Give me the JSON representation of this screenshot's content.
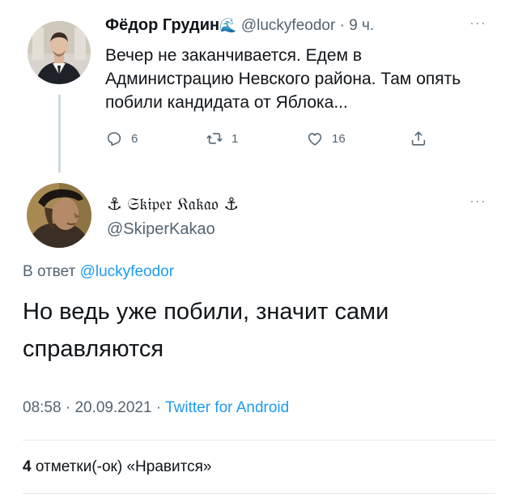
{
  "parent_tweet": {
    "author_name": "Фёдор Грудин",
    "name_emoji": "🌊",
    "handle": "@luckyfeodor",
    "separator": " · ",
    "time": "9 ч.",
    "text": "Вечер не заканчивается. Едем в Администрацию Невского района. Там опять побили кандидата от Яблока...",
    "replies": "6",
    "retweets": "1",
    "likes": "16",
    "more_icon": "more-horizontal-icon"
  },
  "reply_tweet": {
    "author_name": "⚓︎ 𝔖𝔨𝔦𝔭𝔢𝔯 𝔎𝔞𝔨𝔞𝔬 ⚓︎",
    "handle": "@SkiperKakao",
    "reply_prefix": "В ответ ",
    "reply_mention": "@luckyfeodor",
    "text": "Но ведь уже побили, значит сами справляются",
    "time": "08:58",
    "meta_sep": " · ",
    "date": "20.09.2021",
    "source": "Twitter for Android",
    "likes_count": "4",
    "likes_label": " отметки(-ок) «Нравится»"
  },
  "colors": {
    "link": "#1d9bf0",
    "secondary_text": "#536471",
    "thread_line": "#cfd9de"
  }
}
